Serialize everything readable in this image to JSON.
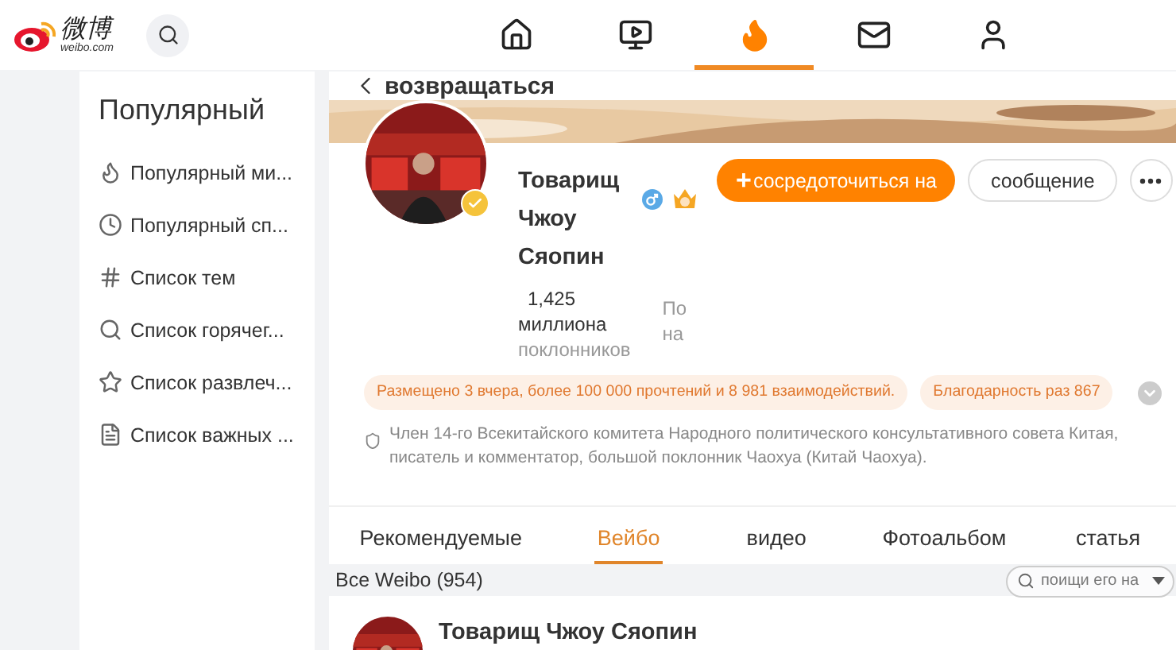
{
  "nav": [
    {
      "kind": "home",
      "selected": false
    },
    {
      "kind": "video",
      "selected": false
    },
    {
      "kind": "hot",
      "selected": true
    },
    {
      "kind": "mail",
      "selected": false
    },
    {
      "kind": "user",
      "selected": false
    }
  ],
  "logo": {
    "name": "微博",
    "domain": "weibo.com"
  },
  "sidebar": {
    "title": "Популярный",
    "items": [
      {
        "kind": "flame",
        "label": "Популярный ми..."
      },
      {
        "kind": "clock",
        "label": "Популярный сп..."
      },
      {
        "kind": "hash",
        "label": "Список тем"
      },
      {
        "kind": "search",
        "label": "Список горячег..."
      },
      {
        "kind": "star",
        "label": "Список развлеч..."
      },
      {
        "kind": "doc",
        "label": "Список важных ..."
      }
    ]
  },
  "back": {
    "label": "возвращаться"
  },
  "profile": {
    "name": "Товарищ Чжоу Сяопин",
    "verified": true,
    "follow_button": "сосредоточиться на",
    "follow_icon": "+",
    "message_button": "сообщение",
    "stats": [
      {
        "value": "1,425",
        "unit": "миллиона",
        "label": "поклонников"
      },
      {
        "unit": "По",
        "label": "на"
      }
    ],
    "highlights": [
      "Размещено 3 вчера, более 100 000 прочтений и 8 981 взаимодействий.",
      "Благодарность раз 867"
    ],
    "bio": "Член 14-го Всекитайского комитета Народного политического консультативного совета Китая, писатель и комментатор, большой поклонник Чаохуа (Китай Чаохуа)."
  },
  "tabs": [
    {
      "label": "Рекомендуемые",
      "selected": false
    },
    {
      "label": "Вейбо",
      "selected": true
    },
    {
      "label": "видео",
      "selected": false
    },
    {
      "label": "Фотоальбом",
      "selected": false
    },
    {
      "label": "статья",
      "selected": false
    }
  ],
  "feed": {
    "title": "Все Weibo (954)",
    "search_placeholder": "поищи его на",
    "post_author": "Товарищ Чжоу Сяопин"
  }
}
